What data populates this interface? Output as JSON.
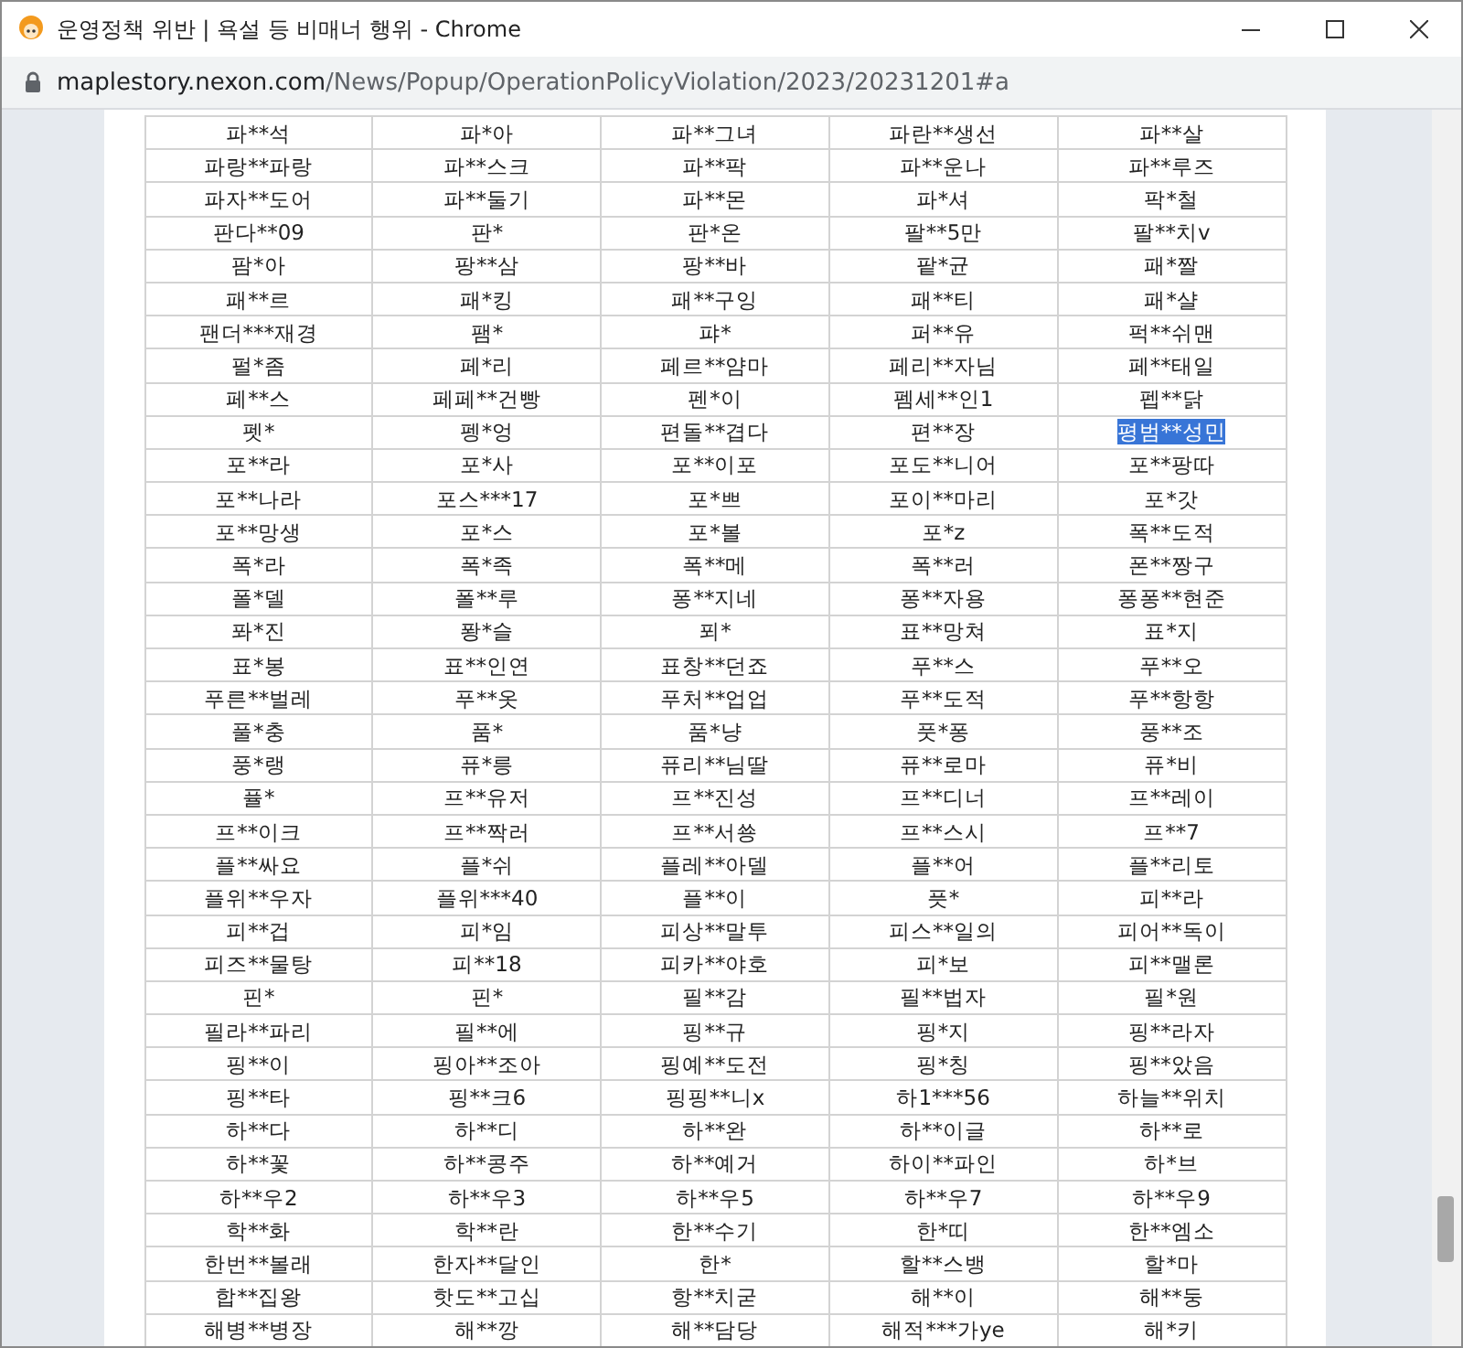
{
  "window": {
    "title": "운영정책 위반 | 욕설 등 비매너 행위 - Chrome"
  },
  "address_bar": {
    "host": "maplestory.nexon.com",
    "path": "/News/Popup/OperationPolicyViolation/2023/20231201#a"
  },
  "table": {
    "rows": [
      {
        "cells": [
          {
            "text": "파**석",
            "selected": false
          },
          {
            "text": "파*아",
            "selected": false
          },
          {
            "text": "파**그녀",
            "selected": false
          },
          {
            "text": "파란**생선",
            "selected": false
          },
          {
            "text": "파**살",
            "selected": false
          }
        ]
      },
      {
        "cells": [
          {
            "text": "파랑**파랑",
            "selected": false
          },
          {
            "text": "파**스크",
            "selected": false
          },
          {
            "text": "파**팍",
            "selected": false
          },
          {
            "text": "파**운나",
            "selected": false
          },
          {
            "text": "파**루즈",
            "selected": false
          }
        ]
      },
      {
        "cells": [
          {
            "text": "파자**도어",
            "selected": false
          },
          {
            "text": "파**둘기",
            "selected": false
          },
          {
            "text": "파**몬",
            "selected": false
          },
          {
            "text": "파*셔",
            "selected": false
          },
          {
            "text": "팍*철",
            "selected": false
          }
        ]
      },
      {
        "cells": [
          {
            "text": "판다**09",
            "selected": false
          },
          {
            "text": "판*",
            "selected": false
          },
          {
            "text": "판*온",
            "selected": false
          },
          {
            "text": "팔**5만",
            "selected": false
          },
          {
            "text": "팔**치v",
            "selected": false
          }
        ]
      },
      {
        "cells": [
          {
            "text": "팜*아",
            "selected": false
          },
          {
            "text": "팡**삼",
            "selected": false
          },
          {
            "text": "팡**바",
            "selected": false
          },
          {
            "text": "팥*균",
            "selected": false
          },
          {
            "text": "패*짤",
            "selected": false
          }
        ]
      },
      {
        "cells": [
          {
            "text": "패**르",
            "selected": false
          },
          {
            "text": "패*킹",
            "selected": false
          },
          {
            "text": "패**구잉",
            "selected": false
          },
          {
            "text": "패**티",
            "selected": false
          },
          {
            "text": "패*샬",
            "selected": false
          }
        ]
      },
      {
        "cells": [
          {
            "text": "팬더***재경",
            "selected": false
          },
          {
            "text": "팸*",
            "selected": false
          },
          {
            "text": "퍄*",
            "selected": false
          },
          {
            "text": "퍼**유",
            "selected": false
          },
          {
            "text": "퍽**쉬맨",
            "selected": false
          }
        ]
      },
      {
        "cells": [
          {
            "text": "펄*좀",
            "selected": false
          },
          {
            "text": "페*리",
            "selected": false
          },
          {
            "text": "페르**얌마",
            "selected": false
          },
          {
            "text": "페리**자님",
            "selected": false
          },
          {
            "text": "페**태일",
            "selected": false
          }
        ]
      },
      {
        "cells": [
          {
            "text": "페**스",
            "selected": false
          },
          {
            "text": "페페**건빵",
            "selected": false
          },
          {
            "text": "펜*이",
            "selected": false
          },
          {
            "text": "펨세**인1",
            "selected": false
          },
          {
            "text": "펩**닭",
            "selected": false
          }
        ]
      },
      {
        "cells": [
          {
            "text": "펫*",
            "selected": false
          },
          {
            "text": "펭*엉",
            "selected": false
          },
          {
            "text": "편돌**겹다",
            "selected": false
          },
          {
            "text": "편**장",
            "selected": false
          },
          {
            "text": "평범**성민",
            "selected": true
          }
        ]
      },
      {
        "cells": [
          {
            "text": "포**라",
            "selected": false
          },
          {
            "text": "포*사",
            "selected": false
          },
          {
            "text": "포**이포",
            "selected": false
          },
          {
            "text": "포도**니어",
            "selected": false
          },
          {
            "text": "포**팡따",
            "selected": false
          }
        ]
      },
      {
        "cells": [
          {
            "text": "포**나라",
            "selected": false
          },
          {
            "text": "포스***17",
            "selected": false
          },
          {
            "text": "포*쁘",
            "selected": false
          },
          {
            "text": "포이**마리",
            "selected": false
          },
          {
            "text": "포*갓",
            "selected": false
          }
        ]
      },
      {
        "cells": [
          {
            "text": "포**망생",
            "selected": false
          },
          {
            "text": "포*스",
            "selected": false
          },
          {
            "text": "포*볼",
            "selected": false
          },
          {
            "text": "포*z",
            "selected": false
          },
          {
            "text": "폭**도적",
            "selected": false
          }
        ]
      },
      {
        "cells": [
          {
            "text": "폭*라",
            "selected": false
          },
          {
            "text": "폭*족",
            "selected": false
          },
          {
            "text": "폭**메",
            "selected": false
          },
          {
            "text": "폭**러",
            "selected": false
          },
          {
            "text": "폰**짱구",
            "selected": false
          }
        ]
      },
      {
        "cells": [
          {
            "text": "폴*델",
            "selected": false
          },
          {
            "text": "폴**루",
            "selected": false
          },
          {
            "text": "퐁**지네",
            "selected": false
          },
          {
            "text": "퐁**자용",
            "selected": false
          },
          {
            "text": "퐁퐁**현준",
            "selected": false
          }
        ]
      },
      {
        "cells": [
          {
            "text": "퐈*진",
            "selected": false
          },
          {
            "text": "퐝*슬",
            "selected": false
          },
          {
            "text": "푀*",
            "selected": false
          },
          {
            "text": "표**망쳐",
            "selected": false
          },
          {
            "text": "표*지",
            "selected": false
          }
        ]
      },
      {
        "cells": [
          {
            "text": "표*봉",
            "selected": false
          },
          {
            "text": "표**인연",
            "selected": false
          },
          {
            "text": "표창**던죠",
            "selected": false
          },
          {
            "text": "푸**스",
            "selected": false
          },
          {
            "text": "푸**오",
            "selected": false
          }
        ]
      },
      {
        "cells": [
          {
            "text": "푸른**벌레",
            "selected": false
          },
          {
            "text": "푸**옷",
            "selected": false
          },
          {
            "text": "푸처**업업",
            "selected": false
          },
          {
            "text": "푸**도적",
            "selected": false
          },
          {
            "text": "푸**항항",
            "selected": false
          }
        ]
      },
      {
        "cells": [
          {
            "text": "풀*충",
            "selected": false
          },
          {
            "text": "품*",
            "selected": false
          },
          {
            "text": "품*냥",
            "selected": false
          },
          {
            "text": "풋*퐁",
            "selected": false
          },
          {
            "text": "풍**조",
            "selected": false
          }
        ]
      },
      {
        "cells": [
          {
            "text": "풍*랭",
            "selected": false
          },
          {
            "text": "퓨*릉",
            "selected": false
          },
          {
            "text": "퓨리**님딸",
            "selected": false
          },
          {
            "text": "퓨**로마",
            "selected": false
          },
          {
            "text": "퓨*비",
            "selected": false
          }
        ]
      },
      {
        "cells": [
          {
            "text": "퓰*",
            "selected": false
          },
          {
            "text": "프**유저",
            "selected": false
          },
          {
            "text": "프**진성",
            "selected": false
          },
          {
            "text": "프**디너",
            "selected": false
          },
          {
            "text": "프**레이",
            "selected": false
          }
        ]
      },
      {
        "cells": [
          {
            "text": "프**이크",
            "selected": false
          },
          {
            "text": "프**짝러",
            "selected": false
          },
          {
            "text": "프**서쑝",
            "selected": false
          },
          {
            "text": "프**스시",
            "selected": false
          },
          {
            "text": "프**7",
            "selected": false
          }
        ]
      },
      {
        "cells": [
          {
            "text": "플**싸요",
            "selected": false
          },
          {
            "text": "플*쉬",
            "selected": false
          },
          {
            "text": "플레**아델",
            "selected": false
          },
          {
            "text": "플**어",
            "selected": false
          },
          {
            "text": "플**리토",
            "selected": false
          }
        ]
      },
      {
        "cells": [
          {
            "text": "플위**우자",
            "selected": false
          },
          {
            "text": "플위***40",
            "selected": false
          },
          {
            "text": "플**이",
            "selected": false
          },
          {
            "text": "픗*",
            "selected": false
          },
          {
            "text": "피**라",
            "selected": false
          }
        ]
      },
      {
        "cells": [
          {
            "text": "피**겁",
            "selected": false
          },
          {
            "text": "피*임",
            "selected": false
          },
          {
            "text": "피상**말투",
            "selected": false
          },
          {
            "text": "피스**일의",
            "selected": false
          },
          {
            "text": "피어**독이",
            "selected": false
          }
        ]
      },
      {
        "cells": [
          {
            "text": "피즈**물탕",
            "selected": false
          },
          {
            "text": "피**18",
            "selected": false
          },
          {
            "text": "피카**야호",
            "selected": false
          },
          {
            "text": "피*보",
            "selected": false
          },
          {
            "text": "피**맬론",
            "selected": false
          }
        ]
      },
      {
        "cells": [
          {
            "text": "핀*",
            "selected": false
          },
          {
            "text": "핀*",
            "selected": false
          },
          {
            "text": "필**감",
            "selected": false
          },
          {
            "text": "필**법자",
            "selected": false
          },
          {
            "text": "필*원",
            "selected": false
          }
        ]
      },
      {
        "cells": [
          {
            "text": "필라**파리",
            "selected": false
          },
          {
            "text": "필**에",
            "selected": false
          },
          {
            "text": "핑**규",
            "selected": false
          },
          {
            "text": "핑*지",
            "selected": false
          },
          {
            "text": "핑**라자",
            "selected": false
          }
        ]
      },
      {
        "cells": [
          {
            "text": "핑**이",
            "selected": false
          },
          {
            "text": "핑아**조아",
            "selected": false
          },
          {
            "text": "핑예**도전",
            "selected": false
          },
          {
            "text": "핑*칭",
            "selected": false
          },
          {
            "text": "핑**았음",
            "selected": false
          }
        ]
      },
      {
        "cells": [
          {
            "text": "핑**타",
            "selected": false
          },
          {
            "text": "핑**크6",
            "selected": false
          },
          {
            "text": "핑핑**니x",
            "selected": false
          },
          {
            "text": "하1***56",
            "selected": false
          },
          {
            "text": "하늘**위치",
            "selected": false
          }
        ]
      },
      {
        "cells": [
          {
            "text": "하**다",
            "selected": false
          },
          {
            "text": "하**디",
            "selected": false
          },
          {
            "text": "하**완",
            "selected": false
          },
          {
            "text": "하**이글",
            "selected": false
          },
          {
            "text": "하**로",
            "selected": false
          }
        ]
      },
      {
        "cells": [
          {
            "text": "하**꽃",
            "selected": false
          },
          {
            "text": "하**콩주",
            "selected": false
          },
          {
            "text": "하**예거",
            "selected": false
          },
          {
            "text": "하이**파인",
            "selected": false
          },
          {
            "text": "하*브",
            "selected": false
          }
        ]
      },
      {
        "cells": [
          {
            "text": "하**우2",
            "selected": false
          },
          {
            "text": "하**우3",
            "selected": false
          },
          {
            "text": "하**우5",
            "selected": false
          },
          {
            "text": "하**우7",
            "selected": false
          },
          {
            "text": "하**우9",
            "selected": false
          }
        ]
      },
      {
        "cells": [
          {
            "text": "학**화",
            "selected": false
          },
          {
            "text": "학**란",
            "selected": false
          },
          {
            "text": "한**수기",
            "selected": false
          },
          {
            "text": "한*띠",
            "selected": false
          },
          {
            "text": "한**엠소",
            "selected": false
          }
        ]
      },
      {
        "cells": [
          {
            "text": "한번**볼래",
            "selected": false
          },
          {
            "text": "한자**달인",
            "selected": false
          },
          {
            "text": "한*",
            "selected": false
          },
          {
            "text": "할**스뱅",
            "selected": false
          },
          {
            "text": "할*마",
            "selected": false
          }
        ]
      },
      {
        "cells": [
          {
            "text": "합**집왕",
            "selected": false
          },
          {
            "text": "핫도**고십",
            "selected": false
          },
          {
            "text": "항**치굳",
            "selected": false
          },
          {
            "text": "해**이",
            "selected": false
          },
          {
            "text": "해**둥",
            "selected": false
          }
        ]
      },
      {
        "cells": [
          {
            "text": "해병**병장",
            "selected": false
          },
          {
            "text": "해**깡",
            "selected": false
          },
          {
            "text": "해**담당",
            "selected": false
          },
          {
            "text": "해적***가ye",
            "selected": false
          },
          {
            "text": "해*키",
            "selected": false
          }
        ]
      }
    ]
  }
}
